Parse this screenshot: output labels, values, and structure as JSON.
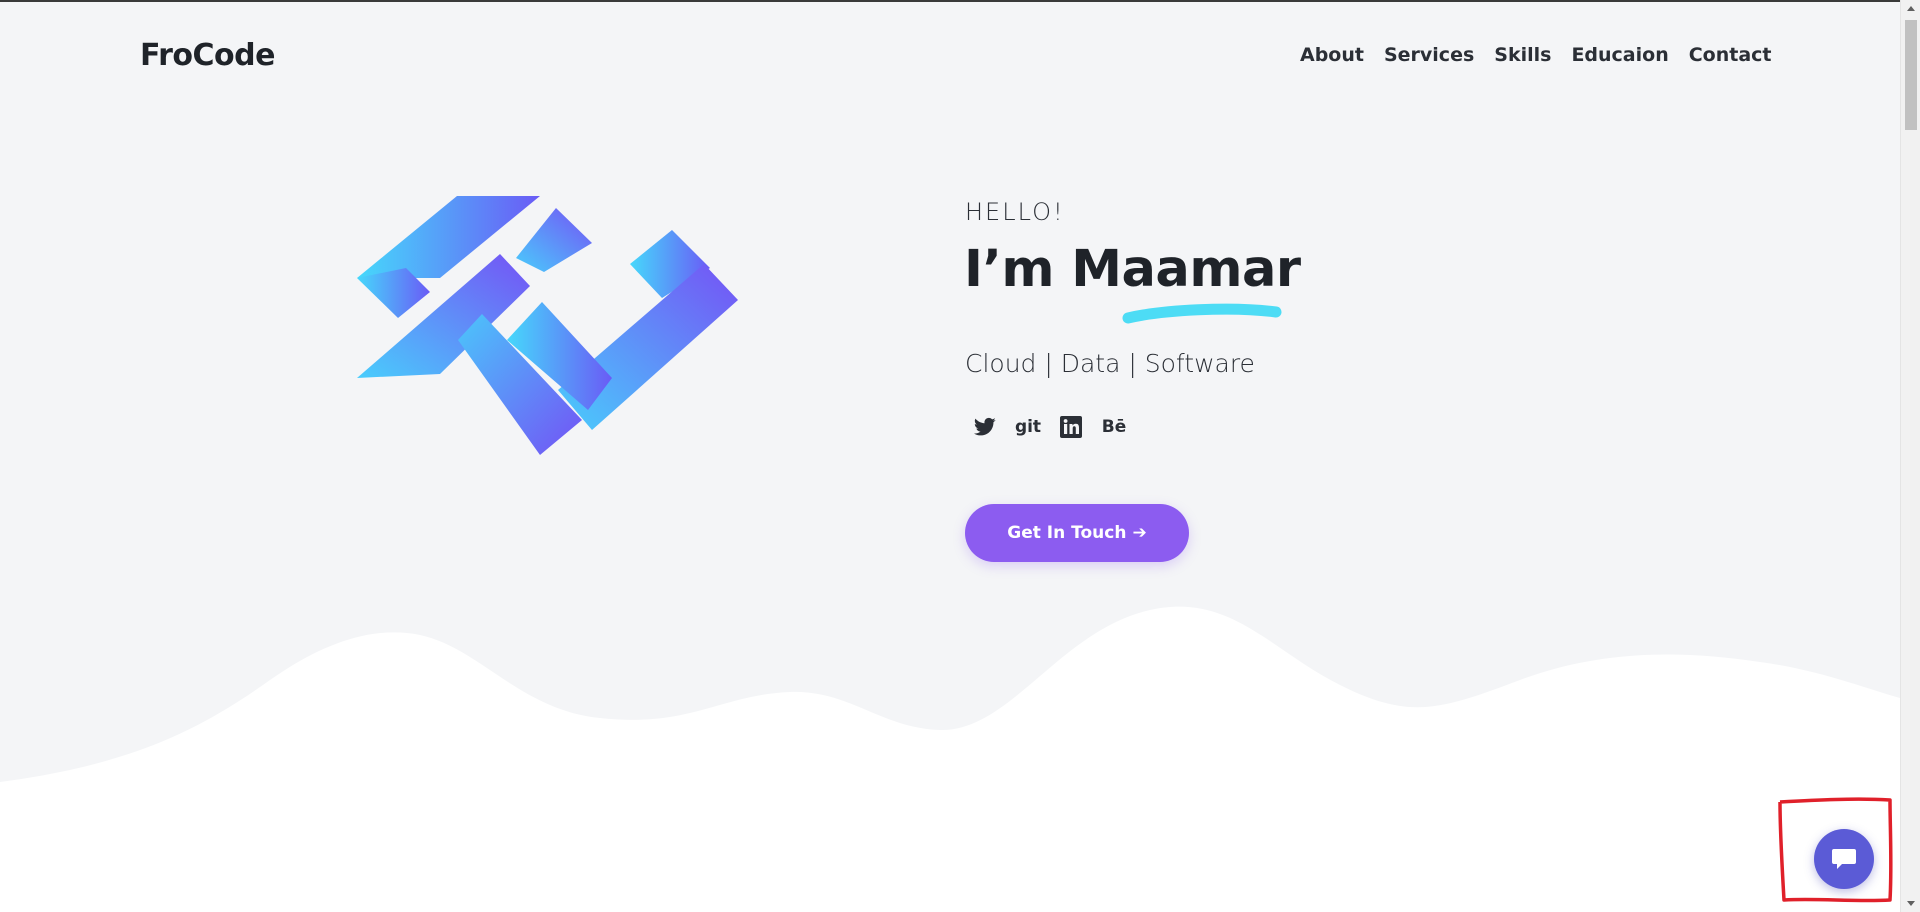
{
  "header": {
    "logo": "FroCode",
    "nav": [
      {
        "label": "About"
      },
      {
        "label": "Services"
      },
      {
        "label": "Skills"
      },
      {
        "label": "Educaion"
      },
      {
        "label": "Contact"
      }
    ]
  },
  "hero": {
    "greeting": "HELLO!",
    "name": "I’m Maamar",
    "tagline": "Cloud | Data | Software",
    "socials": [
      {
        "icon": "twitter-icon"
      },
      {
        "icon": "git-icon",
        "text": "git"
      },
      {
        "icon": "linkedin-icon"
      },
      {
        "icon": "behance-icon",
        "text": "Bē"
      }
    ],
    "cta_label": "Get In Touch",
    "cta_arrow": "➔"
  },
  "colors": {
    "accent": "#8c5cf0",
    "underline": "#4ddcf5",
    "chat": "#5b5bd6",
    "background": "#f4f5f7",
    "annotation": "#e0202a"
  },
  "chat_widget": {
    "icon": "chat-bubble-icon"
  }
}
